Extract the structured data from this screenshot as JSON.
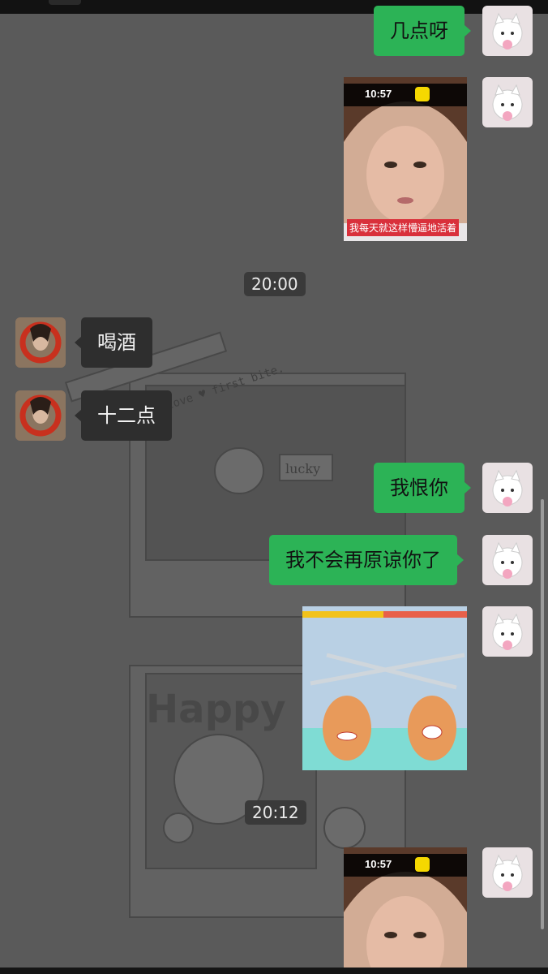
{
  "messages": {
    "m1_text": "几点呀",
    "video1": {
      "time": "10:57",
      "caption": "我每天就这样懵逼地活着"
    },
    "time_separator_1": "20:00",
    "m2_text": "喝酒",
    "m3_text": "十二点",
    "m4_text": "我恨你",
    "m5_text": "我不会再原谅你了",
    "time_separator_2": "20:12",
    "video2": {
      "time": "10:57"
    }
  },
  "wallpaper_text": {
    "tape": "I believe in love ♥ first bite.",
    "lucky": "lucky",
    "happy": "Happy"
  },
  "colors": {
    "background": "#5a5a5a",
    "outgoing_bubble": "#2cb356",
    "incoming_bubble": "#2e2e2e"
  }
}
